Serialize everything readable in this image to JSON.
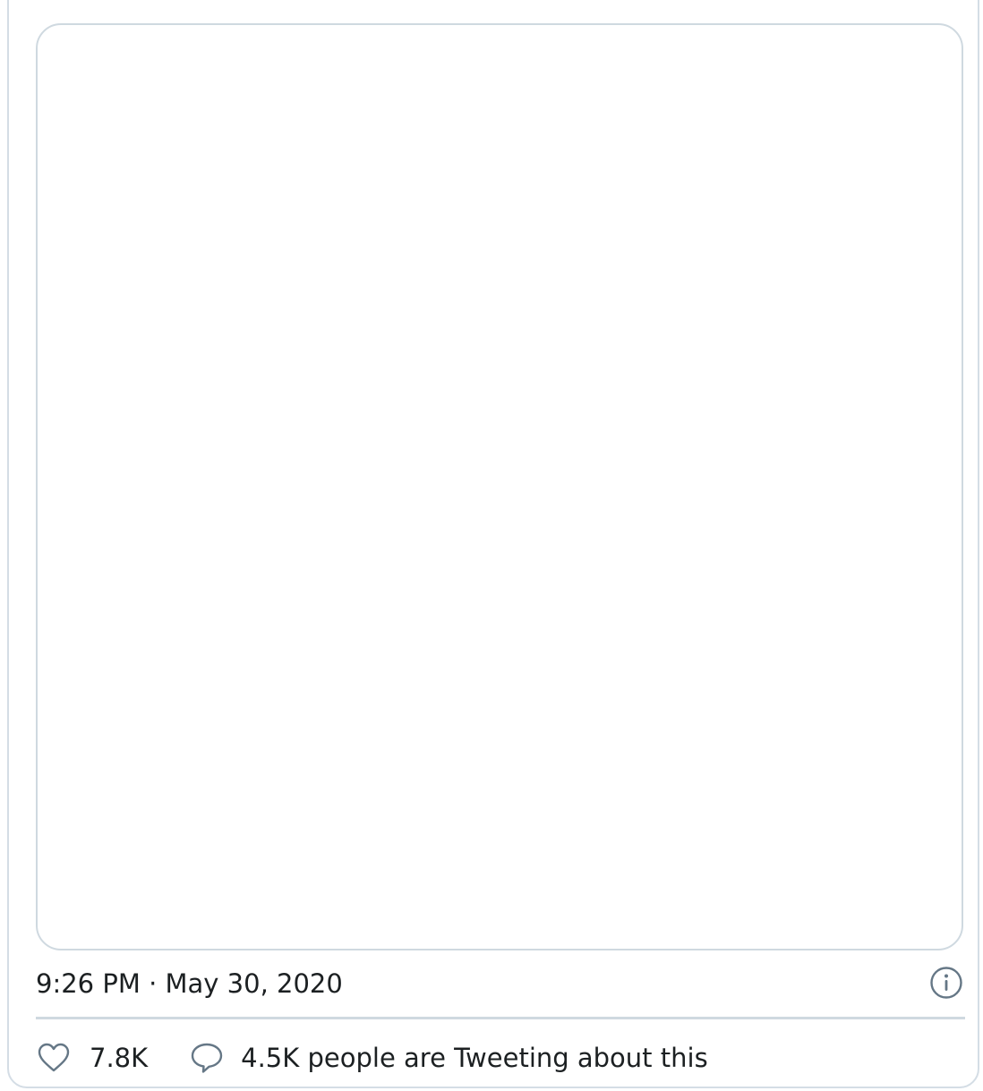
{
  "tweet": {
    "timestamp": "9:26 PM · May 30, 2020",
    "info_icon": "info-icon",
    "actions": {
      "like_icon": "heart-icon",
      "like_count": "7.8K",
      "comment_icon": "speech-bubble-icon",
      "comment_text": "4.5K people are Tweeting about this"
    }
  },
  "colors": {
    "border": "#cfd9e0",
    "text": "#1c2022",
    "icon": "#657786"
  }
}
